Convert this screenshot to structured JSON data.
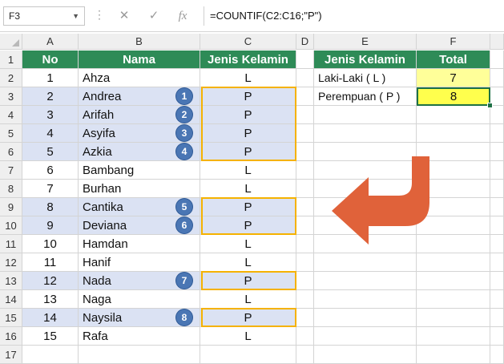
{
  "formula_bar": {
    "name_box": "F3",
    "cancel_icon": "✕",
    "enter_icon": "✓",
    "fx_label": "fx",
    "formula": "=COUNTIF(C2:C16;\"P\")"
  },
  "columns": [
    "A",
    "B",
    "C",
    "D",
    "E",
    "F"
  ],
  "row_numbers": [
    "1",
    "2",
    "3",
    "4",
    "5",
    "6",
    "7",
    "8",
    "9",
    "10",
    "11",
    "12",
    "13",
    "14",
    "15",
    "16",
    "17"
  ],
  "table_headers": {
    "no": "No",
    "nama": "Nama",
    "jenis_kelamin": "Jenis Kelamin"
  },
  "rows": [
    {
      "no": "1",
      "nama": "Ahza",
      "jk": "L"
    },
    {
      "no": "2",
      "nama": "Andrea",
      "jk": "P",
      "badge": "1"
    },
    {
      "no": "3",
      "nama": "Arifah",
      "jk": "P",
      "badge": "2"
    },
    {
      "no": "4",
      "nama": "Asyifa",
      "jk": "P",
      "badge": "3"
    },
    {
      "no": "5",
      "nama": "Azkia",
      "jk": "P",
      "badge": "4"
    },
    {
      "no": "6",
      "nama": "Bambang",
      "jk": "L"
    },
    {
      "no": "7",
      "nama": "Burhan",
      "jk": "L"
    },
    {
      "no": "8",
      "nama": "Cantika",
      "jk": "P",
      "badge": "5"
    },
    {
      "no": "9",
      "nama": "Deviana",
      "jk": "P",
      "badge": "6"
    },
    {
      "no": "10",
      "nama": "Hamdan",
      "jk": "L"
    },
    {
      "no": "11",
      "nama": "Hanif",
      "jk": "L"
    },
    {
      "no": "12",
      "nama": "Nada",
      "jk": "P",
      "badge": "7"
    },
    {
      "no": "13",
      "nama": "Naga",
      "jk": "L"
    },
    {
      "no": "14",
      "nama": "Naysila",
      "jk": "P",
      "badge": "8"
    },
    {
      "no": "15",
      "nama": "Rafa",
      "jk": "L"
    }
  ],
  "summary": {
    "header_label": "Jenis Kelamin",
    "header_total": "Total",
    "laki_label": "Laki-Laki ( L )",
    "laki_total": "7",
    "perempuan_label": "Perempuan ( P )",
    "perempuan_total": "8"
  },
  "colors": {
    "header_green": "#2e8b57",
    "highlight_blue": "#dbe2f3",
    "badge_blue": "#4a76b4",
    "arrow_orange": "#e0623a",
    "outline_gold": "#f5b200",
    "total_yellow": "#ffff99"
  }
}
